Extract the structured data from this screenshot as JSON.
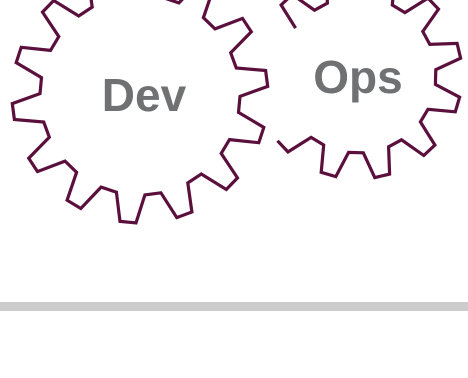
{
  "gears": {
    "dev": {
      "label": "Dev"
    },
    "ops": {
      "label": "Ops"
    }
  },
  "colors": {
    "gear_stroke": "#5a0f3c",
    "label_text": "#707173",
    "divider": "#cccccc",
    "background": "#ffffff"
  }
}
